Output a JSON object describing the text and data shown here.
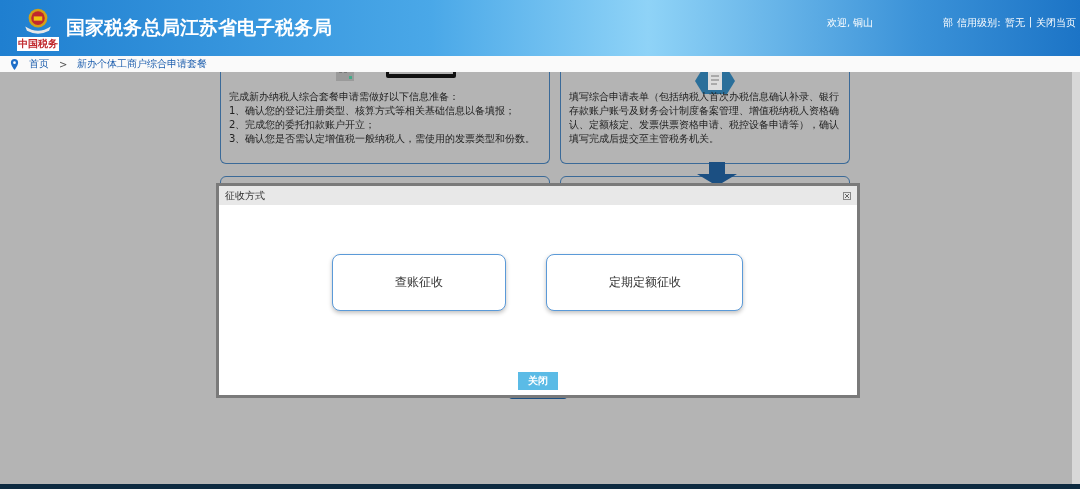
{
  "header": {
    "title": "国家税务总局江苏省电子税务局",
    "logo_caption": "中国税务",
    "welcome": "欢迎, 铜山",
    "department": "部",
    "credit_label": "信用级别:",
    "credit_value": "暂无",
    "separator": "|",
    "close_page": "关闭当页"
  },
  "breadcrumb": [
    {
      "label": "首页"
    },
    {
      "label": ">"
    },
    {
      "label": "新办个体工商户综合申请套餐"
    }
  ],
  "steps": [
    {
      "lines": [
        "完成新办纳税人综合套餐申请需做好以下信息准备：",
        "1、确认您的登记注册类型、核算方式等相关基础信息以备填报；",
        "2、完成您的委托扣款账户开立；",
        "3、确认您是否需认定增值税一般纳税人，需使用的发票类型和份数。"
      ]
    },
    {
      "lines": [
        "填写综合申请表单（包括纳税人首次办税信息确认补录、银行存款账户账号及财务会计制度备案管理、增值税纳税人资格确认、定额核定、发票供票资格申请、税控设备申请等），确认填写完成后提交至主管税务机关。"
      ]
    }
  ],
  "dialog": {
    "title": "征收方式",
    "options": [
      {
        "label": "查账征收"
      },
      {
        "label": "定期定额征收"
      }
    ],
    "close_button": "关闭"
  }
}
